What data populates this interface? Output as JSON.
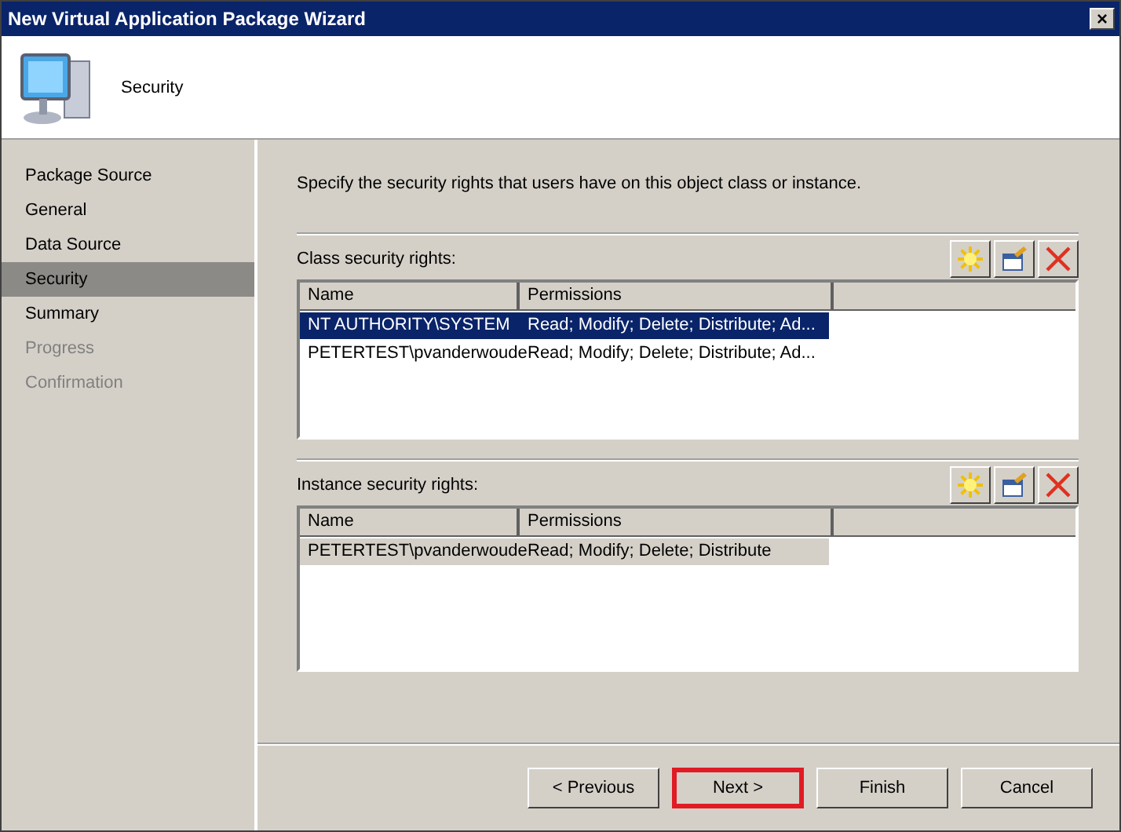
{
  "window": {
    "title": "New Virtual Application Package Wizard",
    "close": "×"
  },
  "header": {
    "title": "Security"
  },
  "steps": [
    {
      "label": "Package Source",
      "selected": false,
      "disabled": false
    },
    {
      "label": "General",
      "selected": false,
      "disabled": false
    },
    {
      "label": "Data Source",
      "selected": false,
      "disabled": false
    },
    {
      "label": "Security",
      "selected": true,
      "disabled": false
    },
    {
      "label": "Summary",
      "selected": false,
      "disabled": false
    },
    {
      "label": "Progress",
      "selected": false,
      "disabled": true
    },
    {
      "label": "Confirmation",
      "selected": false,
      "disabled": true
    }
  ],
  "instruction": "Specify the security rights that users have on this object class or instance.",
  "groups": [
    {
      "label": "Class security rights:",
      "focused": true,
      "columns": [
        "Name",
        "Permissions"
      ],
      "rows": [
        {
          "cells": [
            "NT AUTHORITY\\SYSTEM",
            "Read; Modify; Delete; Distribute; Ad..."
          ],
          "selected": true
        },
        {
          "cells": [
            "PETERTEST\\pvanderwoude",
            "Read; Modify; Delete; Distribute; Ad..."
          ],
          "selected": false
        }
      ]
    },
    {
      "label": "Instance security rights:",
      "focused": false,
      "columns": [
        "Name",
        "Permissions"
      ],
      "rows": [
        {
          "cells": [
            "PETERTEST\\pvanderwoude",
            "Read; Modify; Delete; Distribute"
          ],
          "selected": true
        }
      ]
    }
  ],
  "buttons": [
    {
      "label": "< Previous",
      "highlighted": false
    },
    {
      "label": "Next >",
      "highlighted": true
    },
    {
      "label": "Finish",
      "highlighted": false
    },
    {
      "label": "Cancel",
      "highlighted": false
    }
  ]
}
